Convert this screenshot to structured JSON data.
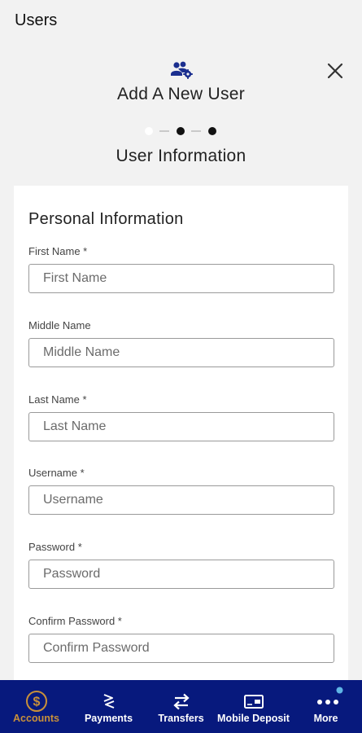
{
  "header": {
    "title": "Users"
  },
  "wizard": {
    "icon": "users-gear-icon",
    "close_icon": "close-icon",
    "title": "Add A New User",
    "step_title": "User Information",
    "steps": {
      "total": 3,
      "current": 2
    }
  },
  "form": {
    "section_title": "Personal Information",
    "fields": [
      {
        "label": "First Name *",
        "placeholder": "First Name",
        "value": ""
      },
      {
        "label": "Middle Name",
        "placeholder": "Middle Name",
        "value": ""
      },
      {
        "label": "Last Name *",
        "placeholder": "Last Name",
        "value": ""
      },
      {
        "label": "Username *",
        "placeholder": "Username",
        "value": ""
      },
      {
        "label": "Password *",
        "placeholder": "Password",
        "value": ""
      },
      {
        "label": "Confirm Password *",
        "placeholder": "Confirm Password",
        "value": ""
      }
    ]
  },
  "nav": {
    "items": [
      {
        "label": "Accounts",
        "icon": "dollar-circle-icon",
        "active": true
      },
      {
        "label": "Payments",
        "icon": "swap-arrows-icon",
        "active": false
      },
      {
        "label": "Transfers",
        "icon": "transfer-arrows-icon",
        "active": false
      },
      {
        "label": "Mobile Deposit",
        "icon": "check-deposit-icon",
        "active": false
      },
      {
        "label": "More",
        "icon": "more-dots-icon",
        "active": false,
        "badge": true
      }
    ]
  },
  "colors": {
    "nav_bg": "#07197d",
    "accent": "#c8903a",
    "wizard_icon": "#1b2f8f",
    "badge": "#5fb5e6"
  }
}
